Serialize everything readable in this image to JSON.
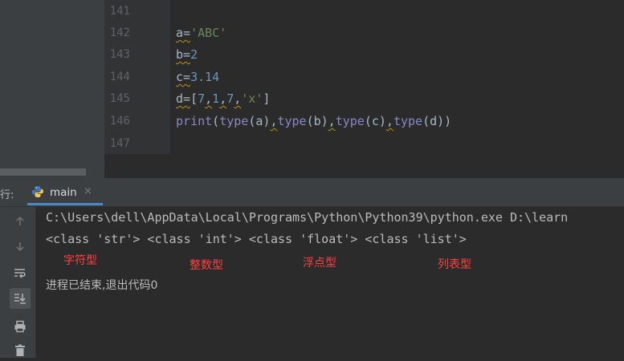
{
  "editor": {
    "lines": [
      {
        "num": "141",
        "code_html": ""
      },
      {
        "num": "142",
        "code_html": "<span class=\"squig\">a=</span><span class=\"str\">'ABC'</span>"
      },
      {
        "num": "143",
        "code_html": "<span class=\"squig\">b=</span><span class=\"num\">2</span>"
      },
      {
        "num": "144",
        "code_html": "<span class=\"squig\">c=</span><span class=\"num\">3.14</span>"
      },
      {
        "num": "145",
        "code_html": "<span class=\"squig\">d=</span>[<span class=\"num\">7</span><span class=\"squig\">,</span><span class=\"num\">1</span><span class=\"squig\">,</span><span class=\"num\">7</span><span class=\"squig\">,</span><span class=\"str\">'x'</span>]"
      },
      {
        "num": "146",
        "code_html": "<span class=\"kw\">print</span>(<span class=\"kw\">type</span>(a)<span class=\"squig\">,</span><span class=\"kw\">type</span>(b)<span class=\"squig\">,</span><span class=\"kw\">type</span>(c)<span class=\"squig\">,</span><span class=\"kw\">type</span>(d))"
      },
      {
        "num": "147",
        "code_html": ""
      }
    ]
  },
  "run_panel": {
    "tab_prefix": "行:",
    "tab_label": "main",
    "tab_close": "×"
  },
  "console": {
    "command": "C:\\Users\\dell\\AppData\\Local\\Programs\\Python\\Python39\\python.exe D:\\learn",
    "output": "<class 'str'> <class 'int'> <class 'float'> <class 'list'>",
    "annotations": [
      "字符型",
      "整数型",
      "浮点型",
      "列表型"
    ],
    "exit_message": "进程已结束,退出代码0"
  },
  "icons": {
    "rerun": "arrow-up-icon",
    "stop": "arrow-down-icon",
    "wrap": "soft-wrap-icon",
    "scroll_end": "scroll-to-end-icon",
    "print": "print-icon",
    "trash": "trash-icon"
  },
  "colors": {
    "background": "#2b2b2b",
    "panel": "#3c3f41",
    "string": "#6a8759",
    "number": "#6897bb",
    "builtin": "#8888c6",
    "annotation": "#ff4040"
  }
}
